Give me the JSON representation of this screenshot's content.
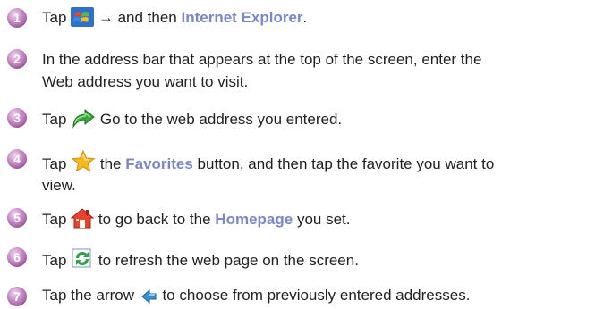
{
  "steps": [
    {
      "number": "1",
      "text_a": "Tap ",
      "icon": "windows-start-icon",
      "text_b": " → and then ",
      "highlight": "Internet Explorer",
      "text_c": "."
    },
    {
      "number": "2",
      "line1": "In the address bar that appears at the top of the screen, enter the",
      "line2": "Web address you want to visit."
    },
    {
      "number": "3",
      "text_a": "Tap ",
      "icon": "go-arrow-icon",
      "text_b": " Go to the web address you entered."
    },
    {
      "number": "4",
      "text_a": "Tap ",
      "icon": "favorites-star-icon",
      "text_b": " the ",
      "highlight": "Favorites",
      "text_c": " button, and then tap the favorite you want to",
      "line2": "view."
    },
    {
      "number": "5",
      "text_a": "Tap ",
      "icon": "home-icon",
      "text_b": " to go back to the ",
      "highlight": "Homepage",
      "text_c": " you set."
    },
    {
      "number": "6",
      "text_a": "Tap ",
      "icon": "refresh-icon",
      "text_b": " to refresh the web page on the screen."
    },
    {
      "number": "7",
      "text_a": "Tap the arrow ",
      "icon": "dropdown-arrow-icon",
      "text_b": " to choose from previously entered addresses."
    }
  ],
  "colors": {
    "highlight": "#7b86c8",
    "badge": "#b57ab5",
    "text": "#231f20"
  }
}
